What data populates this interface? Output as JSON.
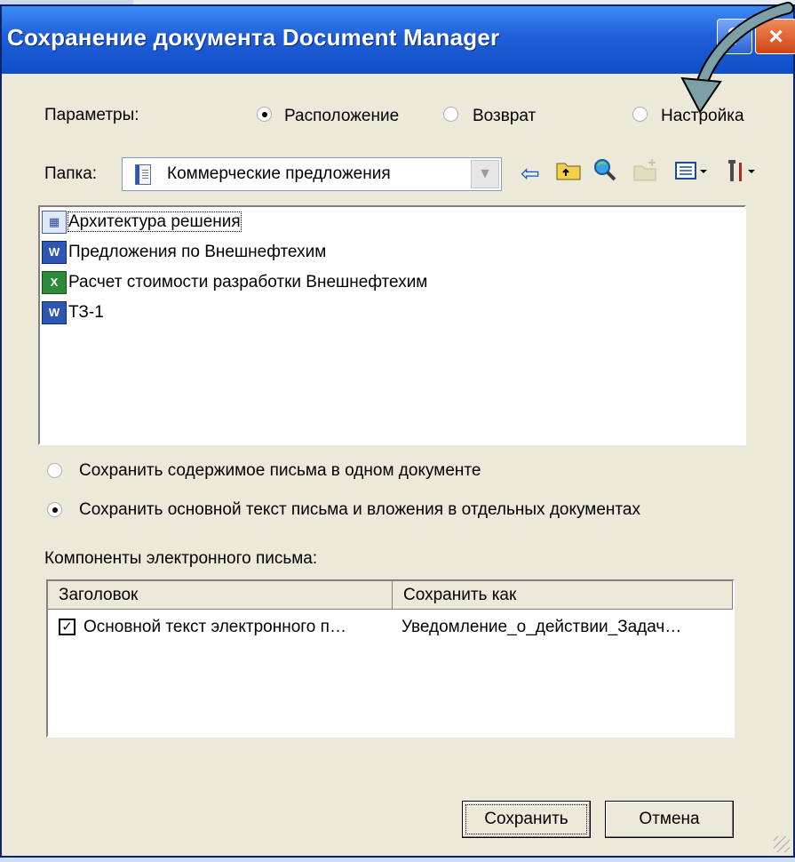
{
  "window": {
    "title": "Сохранение документа Document Manager",
    "help_label": "?",
    "close_label": "×"
  },
  "params": {
    "label": "Параметры:",
    "options": [
      "Расположение",
      "Возврат",
      "Настройка"
    ],
    "selected": "Расположение"
  },
  "folder": {
    "label": "Папка:",
    "value": "Коммерческие предложения"
  },
  "toolbar_icons": [
    "back-arrow-icon",
    "up-folder-icon",
    "search-web-icon",
    "new-folder-icon",
    "view-menu-icon",
    "tools-menu-icon"
  ],
  "files": [
    {
      "name": "Архитектура решения",
      "type": "image"
    },
    {
      "name": "Предложения по Внешнефтехим",
      "type": "word"
    },
    {
      "name": "Расчет стоимости разработки Внешнефтехим",
      "type": "excel"
    },
    {
      "name": "ТЗ-1",
      "type": "word"
    }
  ],
  "save_modes": [
    {
      "label": "Сохранить содержимое письма в одном документе",
      "checked": false
    },
    {
      "label": "Сохранить основной текст письма и вложения в отдельных документах",
      "checked": true
    }
  ],
  "components": {
    "label": "Компоненты электронного письма:",
    "headers": [
      "Заголовок",
      "Сохранить как"
    ],
    "rows": [
      {
        "checked": true,
        "title": "Основной текст электронного п…",
        "save_as": "Уведомление_о_действии_Задач…"
      }
    ]
  },
  "buttons": {
    "save": "Сохранить",
    "cancel": "Отмена"
  }
}
